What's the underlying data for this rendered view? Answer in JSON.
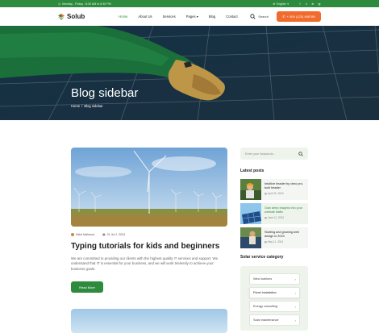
{
  "topbar": {
    "hours": "Monday - Friday : 8:30 AM to 8:30 PM",
    "language": "English",
    "social": [
      "f",
      "x",
      "in",
      "ig"
    ]
  },
  "header": {
    "logo": "Solub",
    "nav": [
      "Home",
      "About Us",
      "Services",
      "Pages",
      "Blog",
      "Contact"
    ],
    "search_label": "Search",
    "cta_label": "+ 000 (123) 456789"
  },
  "hero": {
    "title": "Blog sidebar",
    "breadcrumb_home": "Home",
    "breadcrumb_sep": "/",
    "breadcrumb_current": "Blog sidebar"
  },
  "post": {
    "author": "Sakir Mahmud",
    "date": "01 Jul 2, 2024",
    "title": "Typing tutorials for kids and beginners",
    "excerpt": "We are committed to providing our clients with the highest quality IT services and support. We understand that IT is essential for your business, and we will work tirelessly to achieve your business goals.",
    "read_more": "Read More"
  },
  "sidebar": {
    "search_placeholder": "Enter your keywords...",
    "latest_heading": "Latest posts",
    "latest_posts": [
      {
        "title": "Intuitive header by cheo pro-built header",
        "date": "April 26, 2024"
      },
      {
        "title": "Gain deep insights into your website traffic",
        "date": "June 11, 2024"
      },
      {
        "title": "Starting and growing web design in 2024",
        "date": "May 11, 2024"
      }
    ],
    "category_heading": "Solar service category",
    "categories": [
      "Wind turbines",
      "Panel installation",
      "Energy consulting",
      "Solar maintenance"
    ]
  },
  "colors": {
    "brand_green": "#2e8b3d",
    "accent_orange": "#f06b2c",
    "sidebar_bg": "#eef4ec"
  }
}
